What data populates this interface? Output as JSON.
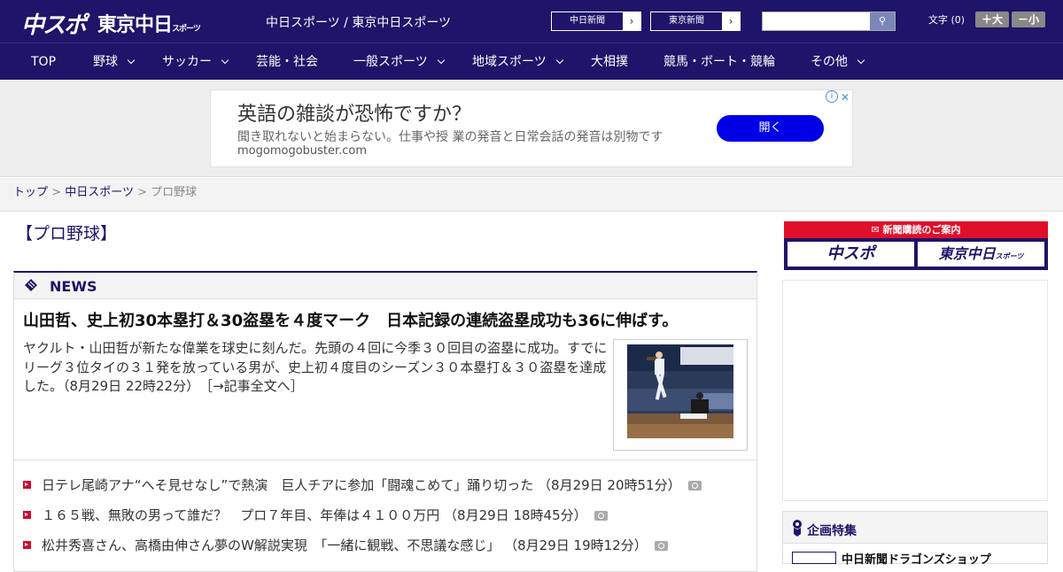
{
  "header": {
    "logo_main": "中スポ",
    "logo_sub": "東京中日",
    "logo_sub_small": "スポーツ",
    "site_links": "中日スポーツ / 東京中日スポーツ",
    "ext_links": [
      {
        "label": "中日新聞"
      },
      {
        "label": "東京新聞"
      }
    ],
    "search_placeholder": "",
    "font_size_label": "文字 (0)",
    "font_up": "＋大",
    "font_down": "－小"
  },
  "nav": {
    "items": [
      {
        "label": "TOP",
        "dropdown": false
      },
      {
        "label": "野球",
        "dropdown": true
      },
      {
        "label": "サッカー",
        "dropdown": true
      },
      {
        "label": "芸能・社会",
        "dropdown": false
      },
      {
        "label": "一般スポーツ",
        "dropdown": true
      },
      {
        "label": "地域スポーツ",
        "dropdown": true
      },
      {
        "label": "大相撲",
        "dropdown": false
      },
      {
        "label": "競馬・ボート・競輪",
        "dropdown": false
      },
      {
        "label": "その他",
        "dropdown": true
      }
    ]
  },
  "ad": {
    "headline": "英語の雑談が恐怖ですか？",
    "subtext": "聞き取れないと始まらない。仕事や授 業の発音と日常会話の発音は別物です",
    "domain": "mogomogobuster.com",
    "button": "開く",
    "info": "i",
    "close": "✕"
  },
  "breadcrumb": {
    "home": "トップ",
    "section": "中日スポーツ",
    "current": "プロ野球",
    "sep": ">"
  },
  "page": {
    "title": "【プロ野球】"
  },
  "news": {
    "label": "NEWS",
    "headline": "山田哲、史上初30本塁打＆30盗塁を４度マーク　日本記録の連続盗塁成功も36に伸ばす。",
    "lead": "ヤクルト・山田哲が新たな偉業を球史に刻んだ。先頭の４回に今季３０回目の盗塁に成功。すでにリーグ３位タイの３１発を放っている男が、史上初４度目のシーズン３０本塁打＆３０盗塁を達成した。（8月29日 22時22分）",
    "more": "［→記事全文へ］",
    "items": [
      {
        "title": "日テレ尾崎アナ“へそ見せなし”で熱演　巨人チアに参加「闘魂こめて」踊り切った",
        "time": "（8月29日 20時51分）"
      },
      {
        "title": "１６５戦、無敗の男って誰だ？　プロ７年目、年俸は４１００万円",
        "time": "（8月29日 18時45分）"
      },
      {
        "title": "松井秀喜さん、高橋由伸さん夢のW解説実現　「一緒に観戦、不思議な感じ」",
        "time": "（8月29日 19時12分）"
      }
    ]
  },
  "sidebar": {
    "subscription_label": "新聞購読のご案内",
    "subscription_buttons": [
      "中スポ",
      "東京中日"
    ],
    "subscription_small": "スポーツ",
    "feature_label": "企画特集",
    "feature_item": "中日新聞ドラゴンズショップ"
  },
  "colors": {
    "brand_navy": "#1e1469",
    "accent_red": "#d10a2a",
    "ad_button": "#0000e6"
  }
}
